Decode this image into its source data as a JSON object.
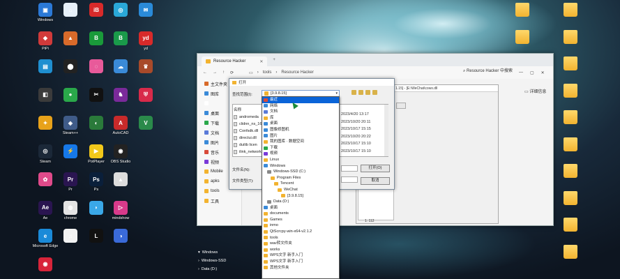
{
  "desktop": {
    "col1": [
      "Windows",
      "",
      "",
      "",
      "",
      "Steam",
      "",
      "",
      "",
      "",
      "",
      ""
    ],
    "col1_labels": [
      "Windows",
      "",
      "",
      "",
      "",
      "Steam",
      "",
      "",
      "",
      "",
      ""
    ],
    "icons_left": [
      {
        "label": "Windows",
        "color": "#2b79d6",
        "glyph": "▣"
      },
      {
        "label": "PiPi",
        "color": "#d13a3a",
        "glyph": "◆"
      },
      {
        "label": "",
        "color": "#1f8fd0",
        "glyph": "▤"
      },
      {
        "label": "",
        "color": "#3b3b3b",
        "glyph": "◧"
      },
      {
        "label": "",
        "color": "#e8a21a",
        "glyph": "✦"
      },
      {
        "label": "Steam",
        "color": "#1b2838",
        "glyph": "◎"
      },
      {
        "label": "",
        "color": "#e04a8a",
        "glyph": "✿"
      },
      {
        "label": "Ae",
        "color": "#2a1550",
        "glyph": "Ae"
      },
      {
        "label": "Microsoft Edge",
        "color": "#1a8ad8",
        "glyph": "e"
      },
      {
        "label": "",
        "color": "#d8243a",
        "glyph": "◉"
      }
    ],
    "icons_col2": [
      {
        "label": "",
        "color": "#e6f0fa",
        "glyph": "⌂"
      },
      {
        "label": "",
        "color": "#d86a2a",
        "glyph": "▲"
      },
      {
        "label": "",
        "color": "#222",
        "glyph": "⬤"
      },
      {
        "label": "",
        "color": "#2aa84a",
        "glyph": "●"
      },
      {
        "label": "Steam++",
        "color": "#3f5b88",
        "glyph": "◈"
      },
      {
        "label": "",
        "color": "#1678e8",
        "glyph": "⚡"
      },
      {
        "label": "Pr",
        "color": "#2a1550",
        "glyph": "Pr"
      },
      {
        "label": "chrome",
        "color": "#e4e4e4",
        "glyph": "◍"
      },
      {
        "label": "",
        "color": "#f2f2f2",
        "glyph": "♫"
      }
    ],
    "icons_col3": [
      {
        "label": "",
        "color": "#d82a2a",
        "glyph": "iB"
      },
      {
        "label": "",
        "color": "#1a9a3a",
        "glyph": "B"
      },
      {
        "label": "",
        "color": "#e85a9a",
        "glyph": "◌"
      },
      {
        "label": "",
        "color": "#111",
        "glyph": "✂"
      },
      {
        "label": "",
        "color": "#2a7a3a",
        "glyph": "◐"
      },
      {
        "label": "PotPlayer",
        "color": "#f2c81a",
        "glyph": "▶"
      },
      {
        "label": "Ps",
        "color": "#0a1f3a",
        "glyph": "Ps"
      },
      {
        "label": "",
        "color": "#3aa8e8",
        "glyph": "◗"
      },
      {
        "label": "",
        "color": "#111",
        "glyph": "L"
      }
    ],
    "icons_col4": [
      {
        "label": "",
        "color": "#2aa8d8",
        "glyph": "◎"
      },
      {
        "label": "",
        "color": "#1a9a4a",
        "glyph": "B"
      },
      {
        "label": "",
        "color": "#3a8ad8",
        "glyph": "☁"
      },
      {
        "label": "",
        "color": "#7a2a9a",
        "glyph": "♞"
      },
      {
        "label": "AutoCAD",
        "color": "#c82a2a",
        "glyph": "A"
      },
      {
        "label": "OBS Studio",
        "color": "#222",
        "glyph": "◉"
      },
      {
        "label": "",
        "color": "#ddd",
        "glyph": "▲"
      },
      {
        "label": "mindshow",
        "color": "#d83a8a",
        "glyph": "▷"
      },
      {
        "label": "",
        "color": "#3a6ad8",
        "glyph": "◑"
      }
    ],
    "icons_col5": [
      {
        "label": "",
        "color": "#2a8ad8",
        "glyph": "✉"
      },
      {
        "label": "yd",
        "color": "#d82a2a",
        "glyph": "yd"
      },
      {
        "label": "",
        "color": "#a84a2a",
        "glyph": "♛"
      },
      {
        "label": "",
        "color": "#d82a4a",
        "glyph": "⛨"
      },
      {
        "label": "",
        "color": "#2a8a4a",
        "glyph": "V"
      }
    ],
    "folders_right": [
      "",
      "",
      "",
      "",
      "",
      "",
      "",
      "",
      "",
      "",
      "",
      "",
      "",
      "",
      ""
    ]
  },
  "resource_hacker": {
    "tab_title": "Resource Hacker",
    "close_glyph": "✕",
    "plus_glyph": "+",
    "nav": [
      "←",
      "→",
      "↑",
      "⟳",
      "▭"
    ],
    "crumbs": [
      "›",
      "tools",
      "›",
      "Resource Hacker"
    ],
    "right_title": "Resource Hacker 中搜索",
    "details": "详细信息",
    "win_controls": [
      "—",
      "▢",
      "✕"
    ],
    "side_items": [
      {
        "label": "主文件夹",
        "color": "#d86a2a"
      },
      {
        "label": "图库",
        "color": "#3a8ad8"
      },
      {
        "label": "",
        "color": "#fff"
      },
      {
        "label": "桌面",
        "color": "#3a8ad8"
      },
      {
        "label": "下载",
        "color": "#2aa84a"
      },
      {
        "label": "文档",
        "color": "#5a7ad8"
      },
      {
        "label": "图片",
        "color": "#3a8ad8"
      },
      {
        "label": "音乐",
        "color": "#d84a3a"
      },
      {
        "label": "视频",
        "color": "#7a3ad8"
      },
      {
        "label": "Mobile",
        "color": "#f2b330"
      },
      {
        "label": "apks",
        "color": "#f2b330"
      },
      {
        "label": "tools",
        "color": "#f2b330"
      },
      {
        "label": "工具",
        "color": "#f2b330"
      }
    ]
  },
  "inner_window": {
    "path": "1.15] - [E:\\WeChat\\cowx.dll",
    "status": "1: 112"
  },
  "open_dialog": {
    "title": "打开",
    "lookin_label": "查找范围(I):",
    "lookin_value": "[3.9.8.15]",
    "name_header": "名称",
    "files": [
      "andromeda",
      "clidnn_ns_16",
      "Confsdk.dll",
      "directui.dll",
      "duilib licen",
      "ilink_network"
    ],
    "dates": [
      "2023/4/20 13:17",
      "2023/10/20 20:11",
      "2023/10/17 15:15",
      "2023/10/20 20:22",
      "2023/10/17 15:10",
      "2023/10/17 15:10"
    ],
    "filename_label": "文件名(N):",
    "filetype_label": "文件类型(T):",
    "open_button": "打开(O)",
    "cancel_button": "取消"
  },
  "dropdown": {
    "items": [
      {
        "label": "最近",
        "indent": 0,
        "color": "#d84a3a",
        "selected": true
      },
      {
        "label": "网络",
        "indent": 0,
        "color": "#3a8ad8"
      },
      {
        "label": "文档",
        "indent": 0,
        "color": "#5a7ad8"
      },
      {
        "label": "库",
        "indent": 0,
        "color": "#f2b330"
      },
      {
        "label": "桌面",
        "indent": 0,
        "color": "#3a8ad8"
      },
      {
        "label": "图像修图机",
        "indent": 0,
        "color": "#3a8ad8"
      },
      {
        "label": "图片",
        "indent": 0,
        "color": "#3a8ad8"
      },
      {
        "label": "我的图库 · 数据空间",
        "indent": 0,
        "color": "#f2b330"
      },
      {
        "label": "下载",
        "indent": 0,
        "color": "#2aa84a"
      },
      {
        "label": "视频",
        "indent": 0,
        "color": "#7a3ad8"
      },
      {
        "label": "Linux",
        "indent": 0,
        "color": "#f2b330"
      },
      {
        "label": "Windows",
        "indent": 0,
        "color": "#3a8ad8"
      },
      {
        "label": "Windows-SSD (C:)",
        "indent": 1,
        "color": "#888"
      },
      {
        "label": "Program Files",
        "indent": 2,
        "color": "#f2b330"
      },
      {
        "label": "Tencent",
        "indent": 3,
        "color": "#f2b330"
      },
      {
        "label": "WeChat",
        "indent": 4,
        "color": "#f2b330"
      },
      {
        "label": "[3.9.8.15]",
        "indent": 5,
        "color": "#f2b330"
      },
      {
        "label": "Data (D:)",
        "indent": 1,
        "color": "#888"
      },
      {
        "label": "桌面",
        "indent": 0,
        "color": "#3a8ad8"
      },
      {
        "label": "documents",
        "indent": 0,
        "color": "#f2b330"
      },
      {
        "label": "Games",
        "indent": 0,
        "color": "#f2b330"
      },
      {
        "label": "inmo",
        "indent": 0,
        "color": "#f2b330"
      },
      {
        "label": "QtScrcpy-win-x64-v2.1.2",
        "indent": 0,
        "color": "#f2b330"
      },
      {
        "label": "tools",
        "indent": 0,
        "color": "#f2b330"
      },
      {
        "label": "wav转文件夹",
        "indent": 0,
        "color": "#f2b330"
      },
      {
        "label": "works",
        "indent": 0,
        "color": "#f2b330"
      },
      {
        "label": "WPS文字 新手入门",
        "indent": 0,
        "color": "#f2b330"
      },
      {
        "label": "WPS文字 新手入门",
        "indent": 0,
        "color": "#f2b330"
      },
      {
        "label": "其他文件夹",
        "indent": 0,
        "color": "#f2b330"
      }
    ]
  },
  "explorer_nav": [
    {
      "label": "Windows",
      "arrow": "▾"
    },
    {
      "label": "Windows-SSD",
      "arrow": "›"
    },
    {
      "label": "Data (D:)",
      "arrow": "›"
    }
  ]
}
